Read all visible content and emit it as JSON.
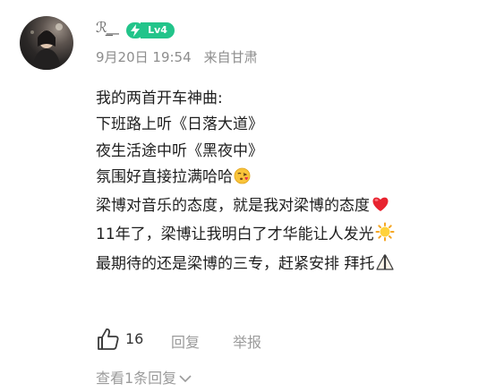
{
  "comment": {
    "username": "ℛ ̲͟",
    "level_badge": "Lv4",
    "date": "9月20日 19:54",
    "location": "来自甘肃",
    "lines": [
      "我的两首开车神曲:",
      "下班路上听《日落大道》",
      "夜生活途中听《黑夜中》",
      "氛围好直接拉满哈哈",
      "梁博对音乐的态度，就是我对梁博的态度",
      "11年了，梁博让我明白了才华能让人发光",
      "最期待的还是梁博的三专，赶紧安排 拜托"
    ],
    "emojis": [
      "kissing-face-emoji",
      "red-heart-emoji",
      "sun-emoji",
      "folded-hands-emoji"
    ]
  },
  "actions": {
    "like_count": "16",
    "reply_label": "回复",
    "report_label": "举报"
  },
  "view_replies_label": "查看1条回复",
  "colors": {
    "badge_green": "#22c48a",
    "meta_gray": "#8d8d8d",
    "text": "#1e1e1e"
  }
}
